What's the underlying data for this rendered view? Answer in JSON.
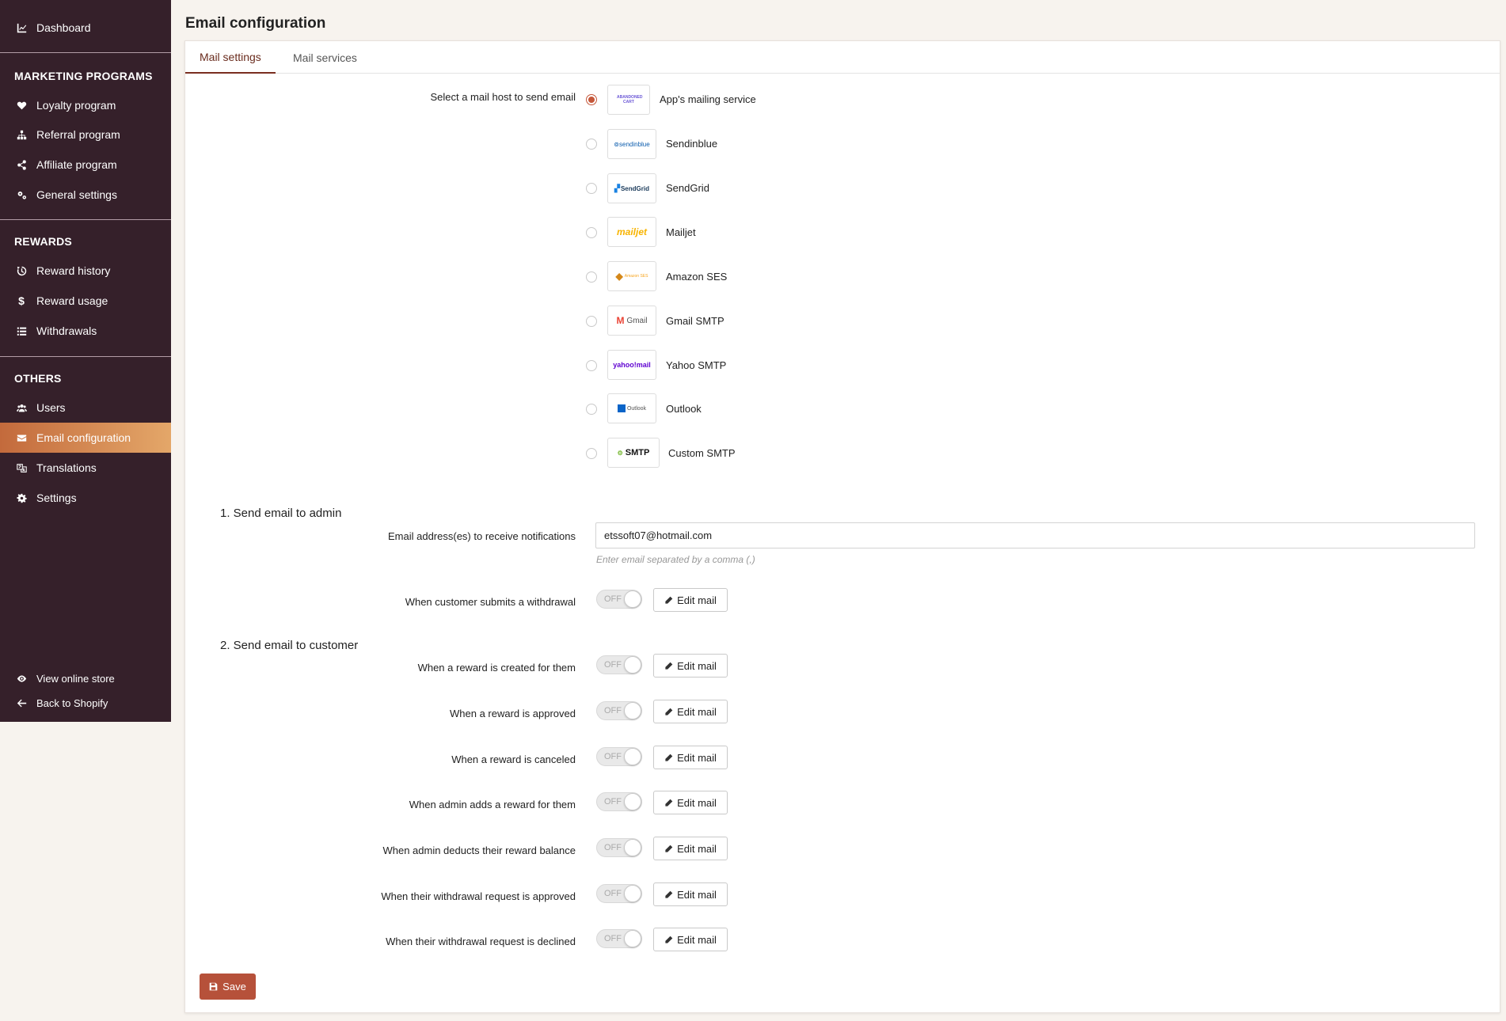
{
  "sidebar": {
    "top": {
      "label": "Dashboard",
      "icon": "chart-line-icon"
    },
    "sections": [
      {
        "title": "MARKETING PROGRAMS",
        "items": [
          {
            "label": "Loyalty program",
            "icon": "heart-icon"
          },
          {
            "label": "Referral program",
            "icon": "sitemap-icon"
          },
          {
            "label": "Affiliate program",
            "icon": "share-icon"
          },
          {
            "label": "General settings",
            "icon": "gears-icon"
          }
        ]
      },
      {
        "title": "REWARDS",
        "items": [
          {
            "label": "Reward history",
            "icon": "history-icon"
          },
          {
            "label": "Reward usage",
            "icon": "dollar-icon"
          },
          {
            "label": "Withdrawals",
            "icon": "list-icon"
          }
        ]
      },
      {
        "title": "OTHERS",
        "items": [
          {
            "label": "Users",
            "icon": "users-icon"
          },
          {
            "label": "Email configuration",
            "icon": "envelope-icon"
          },
          {
            "label": "Translations",
            "icon": "translate-icon"
          },
          {
            "label": "Settings",
            "icon": "gear-icon"
          }
        ]
      }
    ],
    "footer": [
      {
        "label": "View online store",
        "icon": "eye-icon"
      },
      {
        "label": "Back to Shopify",
        "icon": "arrow-left-icon"
      }
    ],
    "active_item": "Email configuration",
    "colors": {
      "background": "#35202a",
      "active_start": "#c36a3c",
      "active_end": "#e4a769"
    }
  },
  "page": {
    "title": "Email configuration"
  },
  "tabs": [
    {
      "label": "Mail settings",
      "active": true
    },
    {
      "label": "Mail services",
      "active": false
    }
  ],
  "mail_host": {
    "label": "Select a mail host to send email",
    "selected": "App's mailing service",
    "options": [
      {
        "name": "App's mailing service",
        "logo_text": "ABANDONED CART",
        "logo_color": "#6b57d6"
      },
      {
        "name": "Sendinblue",
        "logo_text": "⊚sendinblue",
        "logo_color": "#0b5cad"
      },
      {
        "name": "SendGrid",
        "logo_text": "SendGrid",
        "logo_color": "#1a82e2"
      },
      {
        "name": "Mailjet",
        "logo_text": "mailjet",
        "logo_color": "#f8b400"
      },
      {
        "name": "Amazon SES",
        "logo_text": "Amazon SES",
        "logo_color": "#f7a41d"
      },
      {
        "name": "Gmail SMTP",
        "logo_text": "Gmail",
        "logo_color": "#555555"
      },
      {
        "name": "Yahoo SMTP",
        "logo_text": "yahoo!mail",
        "logo_color": "#5f01d1"
      },
      {
        "name": "Outlook",
        "logo_text": "Outlook",
        "logo_color": "#0a64c8"
      },
      {
        "name": "Custom SMTP",
        "logo_text": "SMTP",
        "logo_color": "#111111"
      }
    ]
  },
  "admin_section": {
    "title": "1. Send email to admin",
    "email_label": "Email address(es) to receive notifications",
    "email_value": "etssoft07@hotmail.com",
    "email_hint": "Enter email separated by a comma (,)",
    "notifications": [
      {
        "label": "When customer submits a withdrawal",
        "toggle": "OFF",
        "button": "Edit mail"
      }
    ]
  },
  "customer_section": {
    "title": "2. Send email to customer",
    "notifications": [
      {
        "label": "When a reward is created for them",
        "toggle": "OFF",
        "button": "Edit mail"
      },
      {
        "label": "When a reward is approved",
        "toggle": "OFF",
        "button": "Edit mail"
      },
      {
        "label": "When a reward is canceled",
        "toggle": "OFF",
        "button": "Edit mail"
      },
      {
        "label": "When admin adds a reward for them",
        "toggle": "OFF",
        "button": "Edit mail"
      },
      {
        "label": "When admin deducts their reward balance",
        "toggle": "OFF",
        "button": "Edit mail"
      },
      {
        "label": "When their withdrawal request is approved",
        "toggle": "OFF",
        "button": "Edit mail"
      },
      {
        "label": "When their withdrawal request is declined",
        "toggle": "OFF",
        "button": "Edit mail"
      }
    ]
  },
  "save_button": {
    "label": "Save",
    "color": "#b6513a"
  }
}
